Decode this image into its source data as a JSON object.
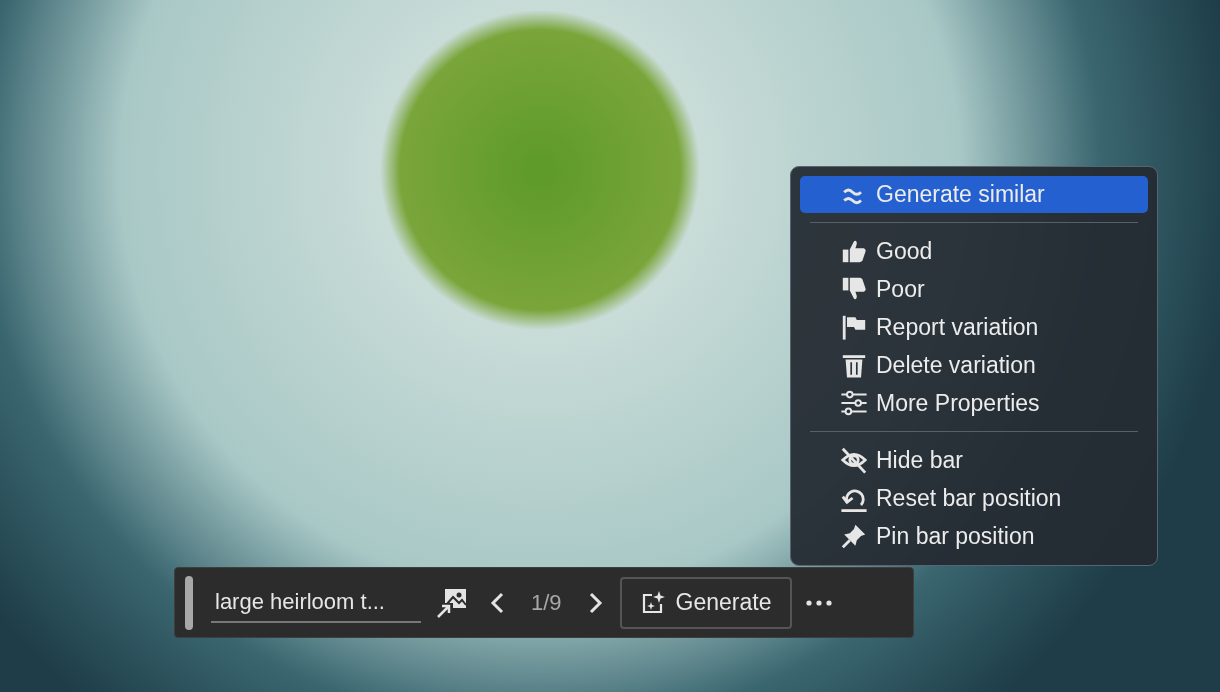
{
  "context_menu": {
    "sections": [
      [
        {
          "label": "Generate similar",
          "selected": true
        }
      ],
      [
        {
          "label": "Good",
          "selected": false
        },
        {
          "label": "Poor",
          "selected": false
        },
        {
          "label": "Report variation",
          "selected": false
        },
        {
          "label": "Delete variation",
          "selected": false
        },
        {
          "label": "More Properties",
          "selected": false
        }
      ],
      [
        {
          "label": "Hide bar",
          "selected": false
        },
        {
          "label": "Reset bar position",
          "selected": false
        },
        {
          "label": "Pin bar position",
          "selected": false
        }
      ]
    ]
  },
  "task_bar": {
    "prompt": {
      "value": "large heirloom t..."
    },
    "counter": "1/9",
    "generate_button": "Generate"
  }
}
